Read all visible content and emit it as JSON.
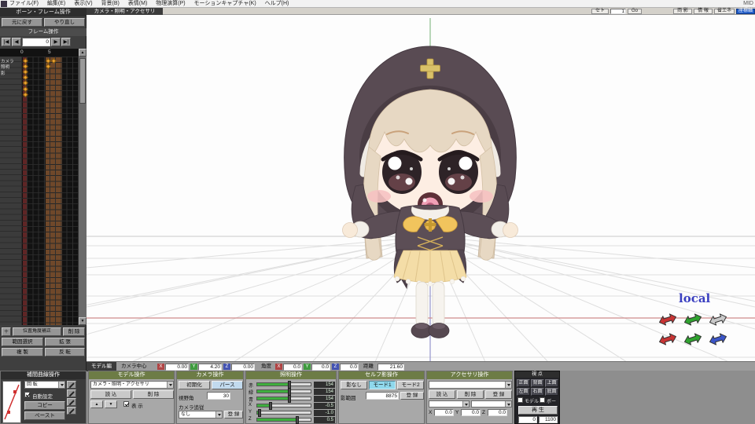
{
  "menu": {
    "items": [
      "ファイル(F)",
      "編集(E)",
      "表示(V)",
      "背景(B)",
      "表情(M)",
      "物理演算(P)",
      "モーションキャプチャ(K)",
      "ヘルプ(H)"
    ],
    "right": "MID"
  },
  "topbar": {
    "tab": "カメラ・照明・アクセサリ",
    "set": "セト",
    "frame": "1",
    "go": "Go",
    "shadow": "両 影",
    "info": "情 報",
    "eco": "省エネ",
    "axis": "座標軸"
  },
  "left": {
    "title": "ボーン・フレーム操作",
    "undo": "元に戻す",
    "redo": "やり直し",
    "frame_ops": "フレーム操作",
    "frame": "0",
    "prev_end": "|◀",
    "prev": "◀",
    "next": "▶",
    "next_end": "▶|",
    "tick0": "0",
    "tick5": "5",
    "rows": [
      "カメラ",
      "照明",
      "影"
    ],
    "plus": "＋",
    "correct": "位置角度補正",
    "del": "削 除",
    "range": "範囲選択",
    "expand": "拡 張",
    "dup": "複 製",
    "flip": "反 転",
    "scroll_up": "▲",
    "scroll_down": "▼"
  },
  "interp": {
    "title": "補間曲線操作",
    "target": "回 転",
    "auto": "自動設定",
    "copy": "コピー",
    "paste": "ペースト"
  },
  "status": {
    "mode": "モデル編",
    "center": "カメラ中心",
    "x": "X",
    "y": "Y",
    "z": "Z",
    "vx": "0.00",
    "vy": "4.20",
    "vz": "0.00",
    "angle": "角度",
    "ax": "0.0",
    "ay": "0.0",
    "az": "0.0",
    "dist": "距離",
    "vdist": "21.60"
  },
  "model": {
    "title": "モデル操作",
    "combo": "カメラ・照明・アクセサリ",
    "load": "読 込",
    "del": "削 除",
    "up": "▲",
    "down": "▼",
    "show": "表 示"
  },
  "camera": {
    "title": "カメラ操作",
    "init": "初期化",
    "pers": "パース",
    "fov_label": "視野角",
    "fov": "30",
    "follow": "カメラ追従",
    "follow_value": "なし",
    "register": "登 録"
  },
  "light": {
    "title": "照明操作",
    "sliders": [
      {
        "label": "赤",
        "value": "154"
      },
      {
        "label": "緑",
        "value": "154"
      },
      {
        "label": "青",
        "value": "154"
      },
      {
        "label": "X",
        "value": "-0.5"
      },
      {
        "label": "Y",
        "value": "-1.0"
      },
      {
        "label": "Z",
        "value": "0.5"
      }
    ]
  },
  "shadow": {
    "title": "セルフ影操作",
    "none": "影なし",
    "mode1": "モード1",
    "mode2": "モード2",
    "range_label": "影範囲",
    "range": "8875",
    "register": "登 録"
  },
  "accessory": {
    "title": "アクセサリ操作",
    "load": "読 込",
    "del": "削 除",
    "register": "登 録",
    "x": "X",
    "y": "Y",
    "z": "Z",
    "vx": "0.0",
    "vy": "0.0",
    "vz": "0.0"
  },
  "view": {
    "title": "視 点",
    "front": "正面",
    "back": "背面",
    "top": "上面",
    "left": "左面",
    "right": "右面",
    "bottom": "底面",
    "model_cb": "モデル",
    "bone_cb": "ボーン",
    "play": "再 生",
    "start": "0",
    "end": "1100"
  },
  "viewport_label": {
    "local": "local"
  }
}
